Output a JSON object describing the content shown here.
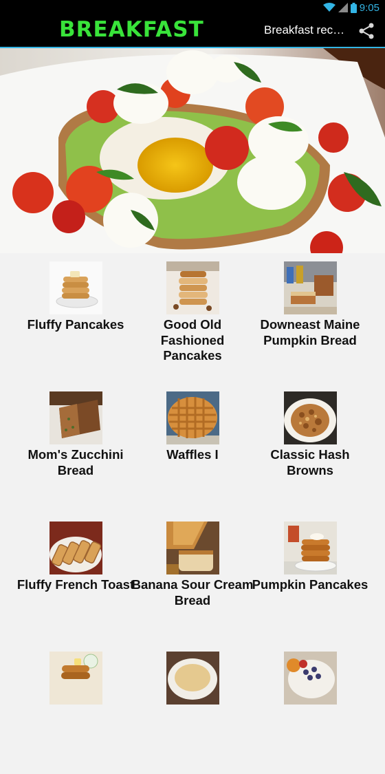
{
  "status_bar": {
    "time": "9:05",
    "icons": [
      "wifi-icon",
      "signal-icon",
      "battery-icon"
    ]
  },
  "action_bar": {
    "app_name": "BREAKFAST",
    "title": "Breakfast rec…",
    "share_icon": "share-icon"
  },
  "colors": {
    "accent": "#33b5e5",
    "logo": "#39e33a",
    "background": "#f2f2f2"
  },
  "recipes": [
    {
      "label": "Fluffy Pancakes"
    },
    {
      "label": "Good Old Fashioned Pancakes"
    },
    {
      "label": "Downeast Maine Pumpkin Bread"
    },
    {
      "label": "Mom's Zucchini Bread"
    },
    {
      "label": "Waffles I"
    },
    {
      "label": "Classic Hash Browns"
    },
    {
      "label": "Fluffy French Toast"
    },
    {
      "label": "Banana Sour Cream Bread"
    },
    {
      "label": "Pumpkin Pancakes"
    },
    {
      "label": ""
    },
    {
      "label": ""
    },
    {
      "label": ""
    }
  ]
}
